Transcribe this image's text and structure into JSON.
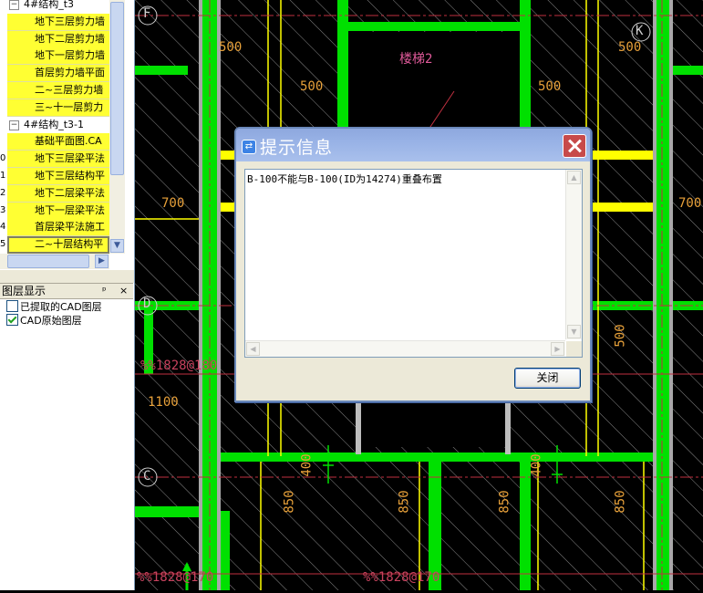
{
  "tree": {
    "rows": [
      {
        "num": "",
        "label": "4#结构_t3",
        "type": "folder",
        "expander": "−"
      },
      {
        "num": "",
        "label": "地下三层剪力墙",
        "type": "leaf"
      },
      {
        "num": "",
        "label": "地下二层剪力墙",
        "type": "leaf"
      },
      {
        "num": "",
        "label": "地下一层剪力墙",
        "type": "leaf"
      },
      {
        "num": "",
        "label": "首层剪力墙平面",
        "type": "leaf"
      },
      {
        "num": "",
        "label": "二~三层剪力墙",
        "type": "leaf"
      },
      {
        "num": "",
        "label": "三~十一层剪力",
        "type": "leaf"
      },
      {
        "num": "",
        "label": "4#结构_t3-1",
        "type": "folder",
        "expander": "−"
      },
      {
        "num": "",
        "label": "基础平面图.CA",
        "type": "leaf"
      },
      {
        "num": "0",
        "label": "地下三层梁平法",
        "type": "leaf"
      },
      {
        "num": "1",
        "label": "地下三层结构平",
        "type": "leaf"
      },
      {
        "num": "2",
        "label": "地下二层梁平法",
        "type": "leaf"
      },
      {
        "num": "3",
        "label": "地下一层梁平法",
        "type": "leaf"
      },
      {
        "num": "4",
        "label": "首层梁平法施工",
        "type": "leaf"
      },
      {
        "num": "5",
        "label": "二~十层结构平",
        "type": "leaf",
        "selected": true
      }
    ]
  },
  "layer_panel": {
    "title": "图层显示",
    "pin_icon": "pin",
    "items": [
      {
        "label": "已提取的CAD图层",
        "checked": false
      },
      {
        "label": "CAD原始图层",
        "checked": true
      }
    ]
  },
  "cad": {
    "labels": {
      "F": "F",
      "K": "K",
      "D": "D",
      "C": "C",
      "d500a": "500",
      "d500b": "500",
      "d500c": "500",
      "d500d": "500",
      "stair": "楼梯2",
      "d700a": "700",
      "d700b": "700",
      "d1100": "1100",
      "d500v": "500",
      "rebar1": "%%1828@180",
      "rebar2": "%%1828@170",
      "rebar3": "%%1828@170",
      "d400a": "400",
      "d400b": "400",
      "d850a": "850",
      "d850b": "850",
      "d850c": "850",
      "d850d": "850"
    }
  },
  "dialog": {
    "title": "提示信息",
    "message": "B-100不能与B-100(ID为14274)重叠布置",
    "close_button": "关闭"
  }
}
